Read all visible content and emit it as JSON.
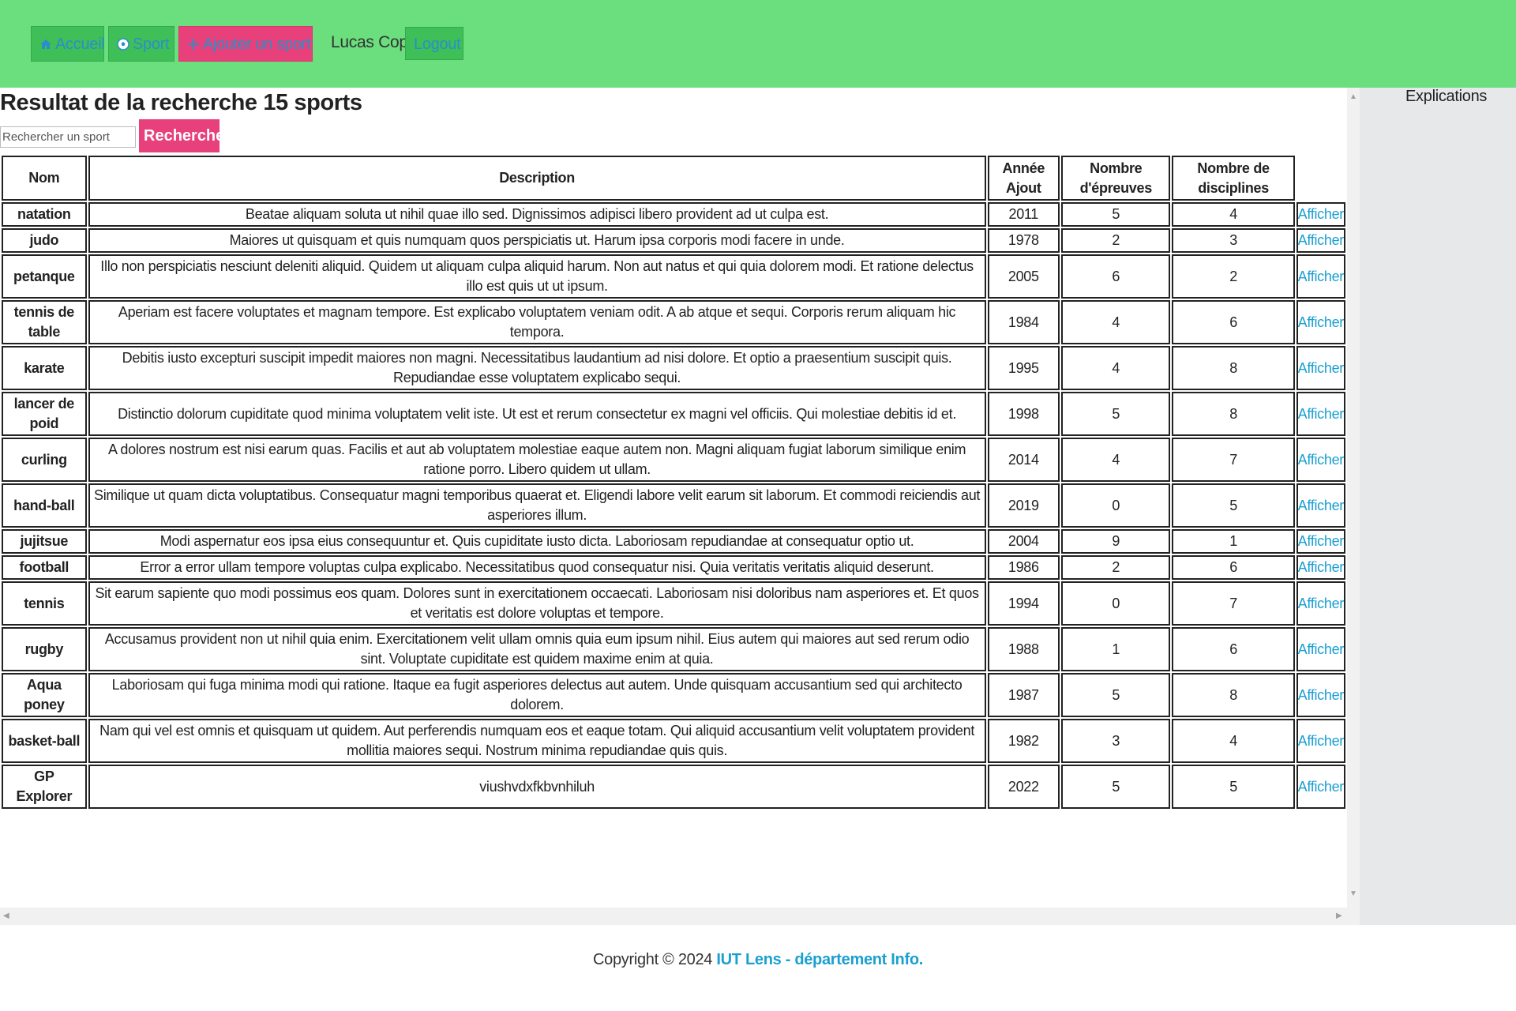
{
  "nav": {
    "home_label": "Accueil",
    "sport_label": "Sport",
    "add_label": "Ajouter un sport",
    "user_name": "Lucas Copin",
    "logout_label": "Logout"
  },
  "colors": {
    "header_bg": "#6bde7e",
    "nav_button": "#3fbf57",
    "accent_pink": "#e8407a",
    "link_blue": "#1a9fd0",
    "aside_bg": "#e7e8ea"
  },
  "icons": {
    "home": "home-icon",
    "sport": "soccer-ball-icon",
    "add": "plus-icon"
  },
  "page": {
    "title": "Resultat de la recherche 15 sports",
    "search_placeholder": "Rechercher un sport",
    "search_button": "Recherche"
  },
  "table": {
    "headers": {
      "name": "Nom",
      "description": "Description",
      "year_line1": "Année",
      "year_line2": "Ajout",
      "events_line1": "Nombre",
      "events_line2": "d'épreuves",
      "disciplines_line1": "Nombre de",
      "disciplines_line2": "disciplines"
    },
    "link_label": "Afficher",
    "rows": [
      {
        "name": "natation",
        "description": "Beatae aliquam soluta ut nihil quae illo sed. Dignissimos adipisci libero provident ad ut culpa est.",
        "year": "2011",
        "events": "5",
        "disciplines": "4"
      },
      {
        "name": "judo",
        "description": "Maiores ut quisquam et quis numquam quos perspiciatis ut. Harum ipsa corporis modi facere in unde.",
        "year": "1978",
        "events": "2",
        "disciplines": "3"
      },
      {
        "name": "petanque",
        "description": "Illo non perspiciatis nesciunt deleniti aliquid. Quidem ut aliquam culpa aliquid harum. Non aut natus et qui quia dolorem modi. Et ratione delectus illo est quis ut ut ipsum.",
        "year": "2005",
        "events": "6",
        "disciplines": "2"
      },
      {
        "name": "tennis de table",
        "description": "Aperiam est facere voluptates et magnam tempore. Est explicabo voluptatem veniam odit. A ab atque et sequi. Corporis rerum aliquam hic tempora.",
        "year": "1984",
        "events": "4",
        "disciplines": "6"
      },
      {
        "name": "karate",
        "description": "Debitis iusto excepturi suscipit impedit maiores non magni. Necessitatibus laudantium ad nisi dolore. Et optio a praesentium suscipit quis. Repudiandae esse voluptatem explicabo sequi.",
        "year": "1995",
        "events": "4",
        "disciplines": "8"
      },
      {
        "name": "lancer de poid",
        "description": "Distinctio dolorum cupiditate quod minima voluptatem velit iste. Ut est et rerum consectetur ex magni vel officiis. Qui molestiae debitis id et.",
        "year": "1998",
        "events": "5",
        "disciplines": "8"
      },
      {
        "name": "curling",
        "description": "A dolores nostrum est nisi earum quas. Facilis et aut ab voluptatem molestiae eaque autem non. Magni aliquam fugiat laborum similique enim ratione porro. Libero quidem ut ullam.",
        "year": "2014",
        "events": "4",
        "disciplines": "7"
      },
      {
        "name": "hand-ball",
        "description": "Similique ut quam dicta voluptatibus. Consequatur magni temporibus quaerat et. Eligendi labore velit earum sit laborum. Et commodi reiciendis aut asperiores illum.",
        "year": "2019",
        "events": "0",
        "disciplines": "5"
      },
      {
        "name": "jujitsue",
        "description": "Modi aspernatur eos ipsa eius consequuntur et. Quis cupiditate iusto dicta. Laboriosam repudiandae at consequatur optio ut.",
        "year": "2004",
        "events": "9",
        "disciplines": "1"
      },
      {
        "name": "football",
        "description": "Error a error ullam tempore voluptas culpa explicabo. Necessitatibus quod consequatur nisi. Quia veritatis veritatis aliquid deserunt.",
        "year": "1986",
        "events": "2",
        "disciplines": "6"
      },
      {
        "name": "tennis",
        "description": "Sit earum sapiente quo modi possimus eos quam. Dolores sunt in exercitationem occaecati. Laboriosam nisi doloribus nam asperiores et. Et quos et veritatis est dolore voluptas et tempore.",
        "year": "1994",
        "events": "0",
        "disciplines": "7"
      },
      {
        "name": "rugby",
        "description": "Accusamus provident non ut nihil quia enim. Exercitationem velit ullam omnis quia eum ipsum nihil. Eius autem qui maiores aut sed rerum odio sint. Voluptate cupiditate est quidem maxime enim at quia.",
        "year": "1988",
        "events": "1",
        "disciplines": "6"
      },
      {
        "name": "Aqua poney",
        "description": "Laboriosam qui fuga minima modi qui ratione. Itaque ea fugit asperiores delectus aut autem. Unde quisquam accusantium sed qui architecto dolorem.",
        "year": "1987",
        "events": "5",
        "disciplines": "8"
      },
      {
        "name": "basket-ball",
        "description": "Nam qui vel est omnis et quisquam ut quidem. Aut perferendis numquam eos et eaque totam. Qui aliquid accusantium velit voluptatem provident mollitia maiores sequi. Nostrum minima repudiandae quis quis.",
        "year": "1982",
        "events": "3",
        "disciplines": "4"
      },
      {
        "name": "GP Explorer",
        "description": "viushvdxfkbvnhiluh",
        "year": "2022",
        "events": "5",
        "disciplines": "5"
      }
    ]
  },
  "aside": {
    "title": "Explications"
  },
  "footer": {
    "copyright": "Copyright © 2024",
    "link": "IUT Lens - département Info."
  }
}
